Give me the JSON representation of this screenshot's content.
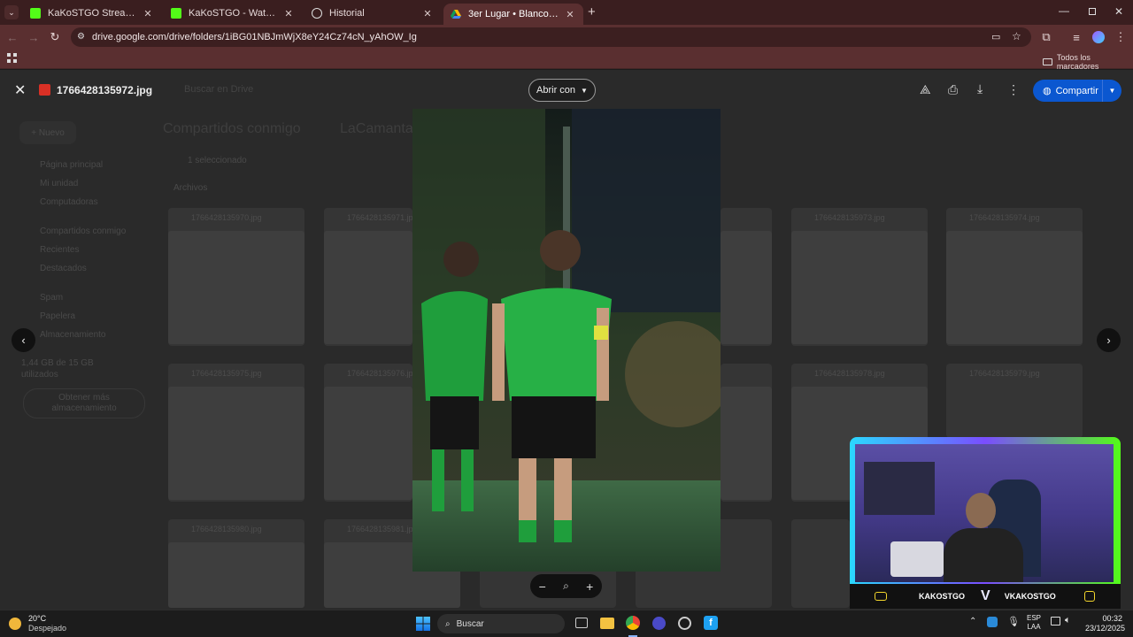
{
  "browser": {
    "tabs": [
      {
        "label": "KaKoSTGO Stream - Watch Live",
        "icon": "kick-icon",
        "active": false
      },
      {
        "label": "KaKoSTGO - Watch the VOD on",
        "icon": "kick-icon",
        "active": false
      },
      {
        "label": "Historial",
        "icon": "history-icon",
        "active": false
      },
      {
        "label": "3er Lugar • Blanco V/S Verde -",
        "icon": "drive-icon",
        "active": true
      }
    ],
    "url": "drive.google.com/drive/folders/1iBG01NBJmWjX8eY24Cz74cN_yAhOW_Ig",
    "bookmarks_label": "Todos los marcadores"
  },
  "viewer": {
    "filename": "1766428135972.jpg",
    "open_with": "Abrir con",
    "share": "Compartir"
  },
  "drive_bg": {
    "search_placeholder": "Buscar en Drive",
    "new_label": "Nuevo",
    "breadcrumb_root": "Compartidos conmigo",
    "breadcrumb_folder": "LaCamanta",
    "selected": "1 seleccionado",
    "section": "Archivos",
    "sidebar": [
      "Página principal",
      "Mi unidad",
      "Computadoras",
      "Compartidos conmigo",
      "Recientes",
      "Destacados",
      "Spam",
      "Papelera",
      "Almacenamiento"
    ],
    "storage_text": "1,44 GB de 15 GB utilizados",
    "storage_button": "Obtener más almacenamiento",
    "thumb_titles": [
      "1766428135970.jpg",
      "1766428135971.jpg",
      "1766428135972.jpg",
      "1766428135973.jpg",
      "1766428135974.jpg",
      "1766428135975.jpg",
      "1766428135976.jpg",
      "1766428135977.jpg",
      "1766428135978.jpg",
      "1766428135979.jpg",
      "1766428135980.jpg",
      "1766428135981.jpg"
    ]
  },
  "webcam": {
    "left_name": "KAKOSTGO",
    "right_name": "VKAKOSTGO"
  },
  "taskbar": {
    "weather_temp": "20°C",
    "weather_desc": "Despejado",
    "search_label": "Buscar",
    "lang_top": "ESP",
    "lang_bottom": "LAA",
    "time": "00:32",
    "date": "23/12/2025"
  },
  "colors": {
    "tab_bar": "#3a1e1f",
    "toolbar": "#5a2f30",
    "share_button": "#0b57d0",
    "kick_green": "#53fc18"
  }
}
